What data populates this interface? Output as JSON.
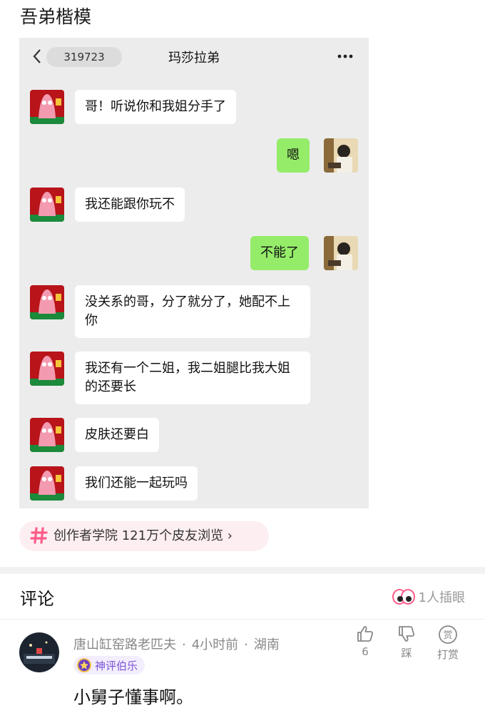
{
  "post": {
    "title": "吾弟楷模"
  },
  "chat": {
    "unread": "319723",
    "name": "玛莎拉弟",
    "messages": [
      {
        "side": "in",
        "text": "哥！听说你和我姐分手了"
      },
      {
        "side": "out",
        "text": "嗯"
      },
      {
        "side": "in",
        "text": "我还能跟你玩不"
      },
      {
        "side": "out",
        "text": "不能了"
      },
      {
        "side": "in",
        "text": "没关系的哥，分了就分了，她配不上你"
      },
      {
        "side": "in",
        "text": "我还有一个二姐，我二姐腿比我大姐的还要长"
      },
      {
        "side": "in",
        "text": "皮肤还要白"
      },
      {
        "side": "in",
        "text": "我们还能一起玩吗"
      }
    ]
  },
  "topic": {
    "text": "创作者学院  121万个皮友浏览 ›"
  },
  "comments": {
    "title": "评论",
    "peek": "1人插眼",
    "items": [
      {
        "user": "唐山缸窑路老匹夫",
        "time": "4小时前",
        "location": "湖南",
        "badge": "神评伯乐",
        "text": "小舅子懂事啊。",
        "like_count": "6",
        "dislike_label": "踩",
        "reward_label": "打赏"
      }
    ]
  },
  "colors": {
    "accent": "#ff5c8a",
    "bubble_out": "#95ec69",
    "badge": "#7c55d6"
  }
}
